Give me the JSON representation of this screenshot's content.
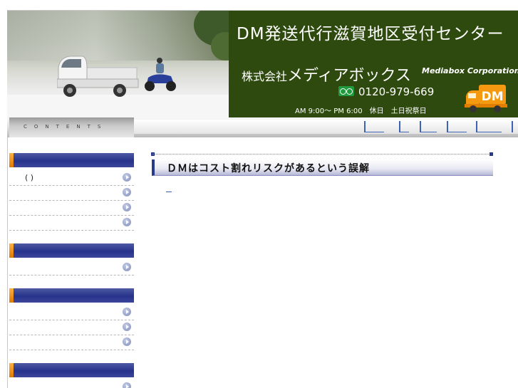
{
  "header": {
    "title": "DM発送代行滋賀地区受付センター",
    "company_prefix": "株式会社",
    "company_name": "メディアボックス",
    "company_en": "Mediabox Corporation",
    "tel": "0120-979-669",
    "hours": "AM 9:00～ PM 6:00　休日　土日祝祭日",
    "logo_text": "DM"
  },
  "contents_bar": {
    "label": "CONTENTS",
    "nav_items": [
      "",
      "",
      "",
      "",
      ""
    ]
  },
  "sidebar": {
    "groups": [
      {
        "items": [
          {
            "label": "(   )"
          },
          {
            "label": ""
          },
          {
            "label": ""
          },
          {
            "label": ""
          }
        ]
      },
      {
        "items": [
          {
            "label": ""
          }
        ]
      },
      {
        "items": [
          {
            "label": ""
          },
          {
            "label": ""
          },
          {
            "label": ""
          }
        ]
      },
      {
        "items": [
          {
            "label": ""
          }
        ]
      }
    ]
  },
  "main": {
    "title": "ＤＭはコスト割れリスクがあるという誤解"
  },
  "colors": {
    "header_green": "#2e4a0e",
    "nav_blue": "#3d63b5",
    "sidebar_blue": "#27338a",
    "accent_orange": "#f59a10"
  }
}
